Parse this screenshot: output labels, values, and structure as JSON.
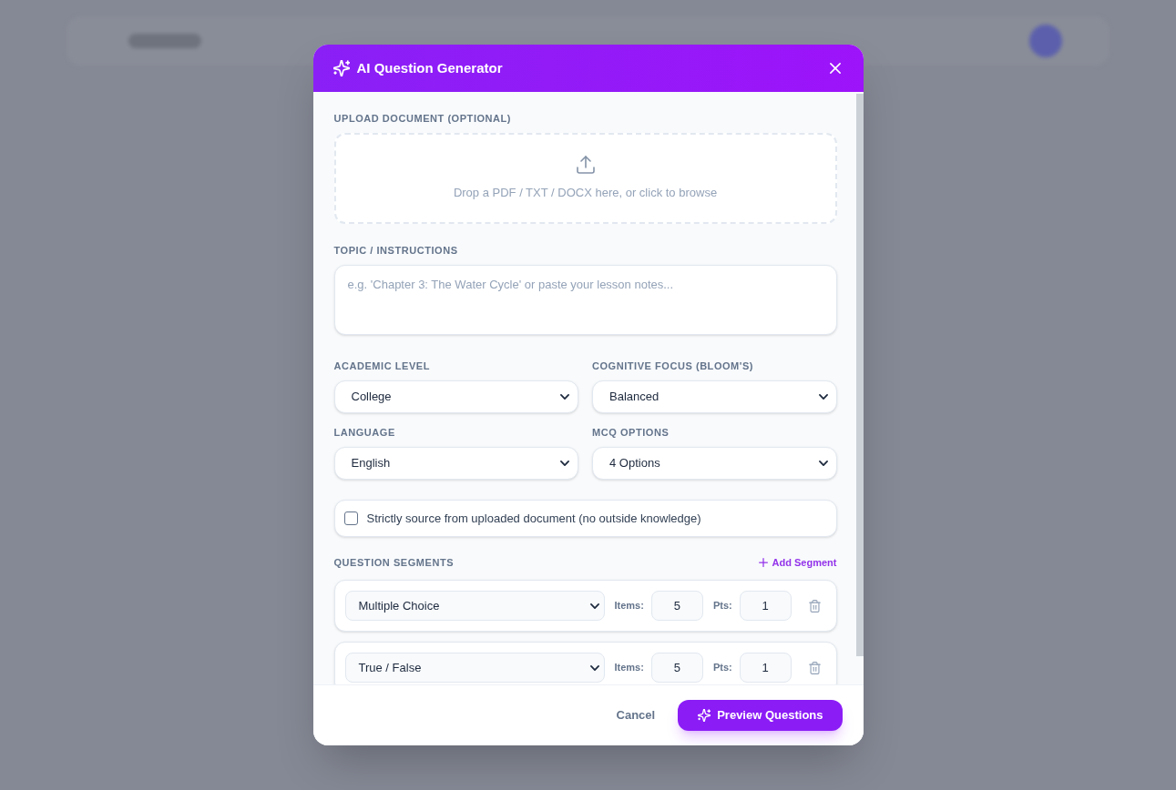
{
  "dialog": {
    "title": "AI Question Generator",
    "upload": {
      "label": "UPLOAD DOCUMENT (OPTIONAL)",
      "prompt": "Drop a PDF / TXT / DOCX here, or click to browse"
    },
    "topic": {
      "label": "TOPIC / INSTRUCTIONS",
      "placeholder": "e.g. 'Chapter 3: The Water Cycle' or paste your lesson notes..."
    },
    "settings": [
      {
        "label": "ACADEMIC LEVEL",
        "value": "College"
      },
      {
        "label": "COGNITIVE FOCUS (BLOOM'S)",
        "value": "Balanced"
      },
      {
        "label": "LANGUAGE",
        "value": "English"
      },
      {
        "label": "MCQ OPTIONS",
        "value": "4 Options"
      }
    ],
    "strict_source": {
      "label": "Strictly source from uploaded document (no outside knowledge)",
      "checked": false
    },
    "segments": {
      "label": "QUESTION SEGMENTS",
      "add_button": "Add Segment",
      "items": [
        {
          "question_type": "Multiple Choice",
          "items_label": "Items:",
          "items": "5",
          "points_label": "Pts:",
          "points": "1"
        },
        {
          "question_type": "True / False",
          "items_label": "Items:",
          "items": "5",
          "points_label": "Pts:",
          "points": "1"
        }
      ]
    },
    "buttons": {
      "cancel": "Cancel",
      "submit": "Preview Questions"
    }
  }
}
